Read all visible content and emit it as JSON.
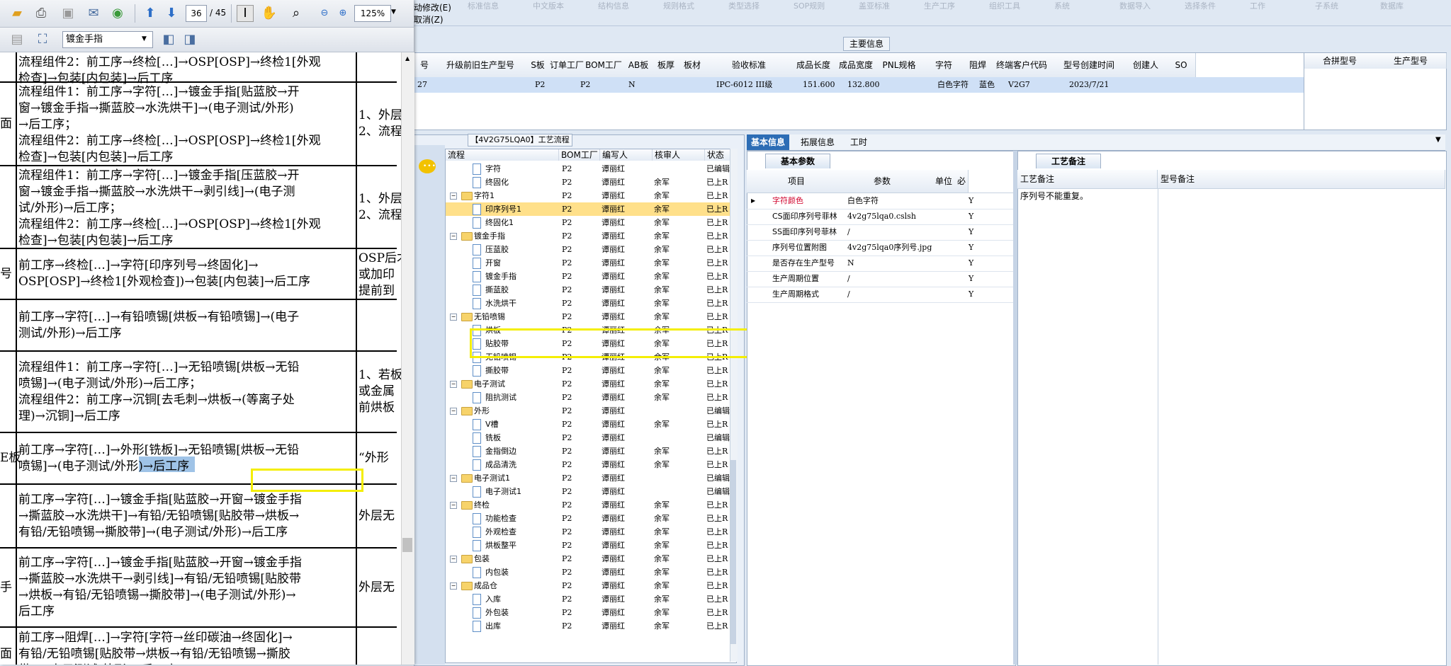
{
  "app": {
    "menu_line1": "动修改(E)",
    "menu_line2": "取消(Z)",
    "menu_faded": [
      "标准信息",
      "中文版本",
      "结构信息",
      "规则格式",
      "类型选择",
      "SOP规则",
      "盖亚标准",
      "生产工序",
      "组织工具",
      "系统",
      "数据导入",
      "选择条件",
      "工作",
      "子系统",
      "数据库"
    ],
    "main_info_label": "主要信息",
    "columns": [
      "号",
      "升级前旧生产型号",
      "S板",
      "订单工厂",
      "BOM工厂",
      "AB板",
      "板厚",
      "板材",
      "验收标准",
      "成品长度",
      "成品宽度",
      "PNL规格",
      "字符",
      "阻焊",
      "终端客户代码",
      "型号创建时间",
      "创建人",
      "SO"
    ],
    "row": {
      "c0": "27",
      "factory": "P2",
      "bom": "P2",
      "ab": "N",
      "std": "IPC-6012 III级",
      "len": "151.600",
      "wid": "132.800",
      "char": "白色字符",
      "mask": "蓝色",
      "cust": "V2G7",
      "date": "2023/7/21"
    },
    "right_columns": [
      "合拼型号",
      "生产型号"
    ]
  },
  "workflow": {
    "title": "【4V2G75LQA0】工艺流程",
    "headers": [
      "流程",
      "BOM工厂",
      "编写人",
      "核审人",
      "状态"
    ],
    "rows": [
      {
        "name": "字符",
        "bom": "P2",
        "writer": "谭丽红",
        "reviewer": "",
        "status": "已编辑",
        "type": "doc",
        "level": 2
      },
      {
        "name": "终固化",
        "bom": "P2",
        "writer": "谭丽红",
        "reviewer": "余军",
        "status": "已上R",
        "type": "doc",
        "level": 2
      },
      {
        "name": "字符1",
        "bom": "P2",
        "writer": "谭丽红",
        "reviewer": "余军",
        "status": "已上R",
        "type": "folder",
        "level": 1
      },
      {
        "name": "印序列号1",
        "bom": "P2",
        "writer": "谭丽红",
        "reviewer": "余军",
        "status": "已上R",
        "type": "doc",
        "level": 2,
        "selected": true
      },
      {
        "name": "终固化1",
        "bom": "P2",
        "writer": "谭丽红",
        "reviewer": "余军",
        "status": "已上R",
        "type": "doc",
        "level": 2
      },
      {
        "name": "镀金手指",
        "bom": "P2",
        "writer": "谭丽红",
        "reviewer": "余军",
        "status": "已上R",
        "type": "folder",
        "level": 1
      },
      {
        "name": "压蓝胶",
        "bom": "P2",
        "writer": "谭丽红",
        "reviewer": "余军",
        "status": "已上R",
        "type": "doc",
        "level": 2
      },
      {
        "name": "开窗",
        "bom": "P2",
        "writer": "谭丽红",
        "reviewer": "余军",
        "status": "已上R",
        "type": "doc",
        "level": 2
      },
      {
        "name": "镀金手指",
        "bom": "P2",
        "writer": "谭丽红",
        "reviewer": "余军",
        "status": "已上R",
        "type": "doc",
        "level": 2
      },
      {
        "name": "撕蓝胶",
        "bom": "P2",
        "writer": "谭丽红",
        "reviewer": "余军",
        "status": "已上R",
        "type": "doc",
        "level": 2
      },
      {
        "name": "水洗烘干",
        "bom": "P2",
        "writer": "谭丽红",
        "reviewer": "余军",
        "status": "已上R",
        "type": "doc",
        "level": 2
      },
      {
        "name": "无铅喷锡",
        "bom": "P2",
        "writer": "谭丽红",
        "reviewer": "余军",
        "status": "已上R",
        "type": "folder",
        "level": 1
      },
      {
        "name": "烘板",
        "bom": "P2",
        "writer": "谭丽红",
        "reviewer": "余军",
        "status": "已上R",
        "type": "doc",
        "level": 2
      },
      {
        "name": "贴胶带",
        "bom": "P2",
        "writer": "谭丽红",
        "reviewer": "余军",
        "status": "已上R",
        "type": "doc",
        "level": 2
      },
      {
        "name": "无铅喷锡",
        "bom": "P2",
        "writer": "谭丽红",
        "reviewer": "余军",
        "status": "已上R",
        "type": "doc",
        "level": 2
      },
      {
        "name": "撕胶带",
        "bom": "P2",
        "writer": "谭丽红",
        "reviewer": "余军",
        "status": "已上R",
        "type": "doc",
        "level": 2
      },
      {
        "name": "电子测试",
        "bom": "P2",
        "writer": "谭丽红",
        "reviewer": "余军",
        "status": "已上R",
        "type": "folder",
        "level": 1
      },
      {
        "name": "阻抗测试",
        "bom": "P2",
        "writer": "谭丽红",
        "reviewer": "余军",
        "status": "已上R",
        "type": "doc",
        "level": 2
      },
      {
        "name": "外形",
        "bom": "P2",
        "writer": "谭丽红",
        "reviewer": "",
        "status": "已编辑",
        "type": "folder",
        "level": 1
      },
      {
        "name": "V槽",
        "bom": "P2",
        "writer": "谭丽红",
        "reviewer": "余军",
        "status": "已上R",
        "type": "doc",
        "level": 2
      },
      {
        "name": "铣板",
        "bom": "P2",
        "writer": "谭丽红",
        "reviewer": "",
        "status": "已编辑",
        "type": "doc",
        "level": 2
      },
      {
        "name": "金指倒边",
        "bom": "P2",
        "writer": "谭丽红",
        "reviewer": "余军",
        "status": "已上R",
        "type": "doc",
        "level": 2
      },
      {
        "name": "成品清洗",
        "bom": "P2",
        "writer": "谭丽红",
        "reviewer": "余军",
        "status": "已上R",
        "type": "doc",
        "level": 2
      },
      {
        "name": "电子测试1",
        "bom": "P2",
        "writer": "谭丽红",
        "reviewer": "",
        "status": "已编辑",
        "type": "folder",
        "level": 1
      },
      {
        "name": "电子测试1",
        "bom": "P2",
        "writer": "谭丽红",
        "reviewer": "",
        "status": "已编辑",
        "type": "doc",
        "level": 2
      },
      {
        "name": "终检",
        "bom": "P2",
        "writer": "谭丽红",
        "reviewer": "余军",
        "status": "已上R",
        "type": "folder",
        "level": 1
      },
      {
        "name": "功能检查",
        "bom": "P2",
        "writer": "谭丽红",
        "reviewer": "余军",
        "status": "已上R",
        "type": "doc",
        "level": 2
      },
      {
        "name": "外观检查",
        "bom": "P2",
        "writer": "谭丽红",
        "reviewer": "余军",
        "status": "已上R",
        "type": "doc",
        "level": 2
      },
      {
        "name": "烘板整平",
        "bom": "P2",
        "writer": "谭丽红",
        "reviewer": "余军",
        "status": "已上R",
        "type": "doc",
        "level": 2
      },
      {
        "name": "包装",
        "bom": "P2",
        "writer": "谭丽红",
        "reviewer": "余军",
        "status": "已上R",
        "type": "folder",
        "level": 1
      },
      {
        "name": "内包装",
        "bom": "P2",
        "writer": "谭丽红",
        "reviewer": "余军",
        "status": "已上R",
        "type": "doc",
        "level": 2
      },
      {
        "name": "成品仓",
        "bom": "P2",
        "writer": "谭丽红",
        "reviewer": "余军",
        "status": "已上R",
        "type": "folder",
        "level": 1
      },
      {
        "name": "入库",
        "bom": "P2",
        "writer": "谭丽红",
        "reviewer": "余军",
        "status": "已上R",
        "type": "doc",
        "level": 2
      },
      {
        "name": "外包装",
        "bom": "P2",
        "writer": "谭丽红",
        "reviewer": "余军",
        "status": "已上R",
        "type": "doc",
        "level": 2
      },
      {
        "name": "出库",
        "bom": "P2",
        "writer": "谭丽红",
        "reviewer": "余军",
        "status": "已上R",
        "type": "doc",
        "level": 2
      }
    ]
  },
  "tabs": [
    "基本信息",
    "拓展信息",
    "工时"
  ],
  "params": {
    "tab": "基本参数",
    "headers": [
      "项目",
      "参数",
      "单位",
      "必"
    ],
    "rows": [
      {
        "item": "字符颜色",
        "value": "白色字符",
        "flag": "Y",
        "red": true
      },
      {
        "item": "CS面印序列号菲林",
        "value": "4v2g75lqa0.cslsh",
        "flag": "Y"
      },
      {
        "item": "SS面印序列号菲林",
        "value": "/",
        "flag": "Y"
      },
      {
        "item": "序列号位置附图",
        "value": "4v2g75lqa0序列号.jpg",
        "flag": "Y"
      },
      {
        "item": "是否存在生产型号",
        "value": "N",
        "flag": "Y"
      },
      {
        "item": "生产周期位置",
        "value": "/",
        "flag": "Y"
      },
      {
        "item": "生产周期格式",
        "value": "/",
        "flag": "Y"
      }
    ]
  },
  "notes": {
    "tab": "工艺备注",
    "col1": "工艺备注",
    "col2": "型号备注",
    "text": "序列号不能重复。"
  },
  "pdf": {
    "page_current": "36",
    "page_total": "/ 45",
    "zoom": "125%",
    "search_value": "镀金手指",
    "rows": [
      {
        "left": "",
        "mid": [
          "流程组件2：前工序→终检[…]→OSP[OSP]→终检1[外观",
          "检查]→包装[内包装]→后工序"
        ],
        "right": [
          ""
        ]
      },
      {
        "left": "面",
        "mid": [
          "流程组件1：前工序→字符[…]→镀金手指[贴蓝胶→开",
          "窗→镀金手指→撕蓝胶→水洗烘干]→(电子测试/外形)",
          "→后工序；",
          "流程组件2：前工序→终检[…]→OSP[OSP]→终检1[外观",
          "检查]→包装[内包装]→后工序"
        ],
        "right": [
          "1、外层",
          "2、流程"
        ]
      },
      {
        "left": "",
        "mid": [
          "流程组件1：前工序→字符[…]→镀金手指[压蓝胶→开",
          "窗→镀金手指→撕蓝胶→水洗烘干→剥引线]→(电子测",
          "试/外形)→后工序；",
          "流程组件2：前工序→终检[…]→OSP[OSP]→终检1[外观",
          "检查]→包装[内包装]→后工序"
        ],
        "right": [
          "1、外层",
          "2、流程"
        ]
      },
      {
        "left": "号",
        "mid": [
          "前工序→终检[…]→字符[印序列号→终固化]→",
          "OSP[OSP]→终检1[外观检查])→包装[内包装]→后工序"
        ],
        "right": [
          "OSP后才",
          "或加印",
          "提前到"
        ]
      },
      {
        "left": "",
        "mid": [
          "前工序→字符[…]→有铅喷锡[烘板→有铅喷锡]→(电子",
          "测试/外形)→后工序"
        ],
        "right": [
          ""
        ]
      },
      {
        "left": "",
        "mid": [
          "流程组件1：前工序→字符[…]→无铅喷锡[烘板→无铅",
          "喷锡]→(电子测试/外形)→后工序；",
          "流程组件2：前工序→沉铜[去毛刺→烘板→(等离子处",
          "理)→沉铜]→后工序"
        ],
        "right": [
          "1、若板",
          "或金属",
          "前烘板"
        ]
      },
      {
        "left": "E板",
        "mid": [
          "前工序→字符[…]→外形[铣板]→无铅喷锡[烘板→无铅",
          "喷锡]→(电子测试/外形)→后工序"
        ],
        "right": [
          "“外形"
        ]
      },
      {
        "left": "",
        "mid": [
          "前工序→字符[…]→镀金手指[贴蓝胶→开窗→镀金手指",
          "→撕蓝胶→水洗烘干]→有铅/无铅喷锡[贴胶带→烘板→",
          "有铅/无铅喷锡→撕胶带]→(电子测试/外形)→后工序"
        ],
        "right": [
          "外层无"
        ]
      },
      {
        "left": "手",
        "mid": [
          "前工序→字符[…]→镀金手指[贴蓝胶→开窗→镀金手指",
          "→撕蓝胶→水洗烘干→剥引线]→有铅/无铅喷锡[贴胶带",
          "→烘板→有铅/无铅喷锡→撕胶带]→(电子测试/外形)→",
          "后工序"
        ],
        "right": [
          "外层无"
        ]
      },
      {
        "left": "面",
        "mid": [
          "前工序→阻焊[…]→字符[字符→丝印碳油→终固化]→",
          "有铅/无铅喷锡[贴胶带→烘板→有铅/无铅喷锡→撕胶",
          "带]→(电子测试/外形)→后工序"
        ],
        "right": [
          ""
        ]
      }
    ]
  }
}
